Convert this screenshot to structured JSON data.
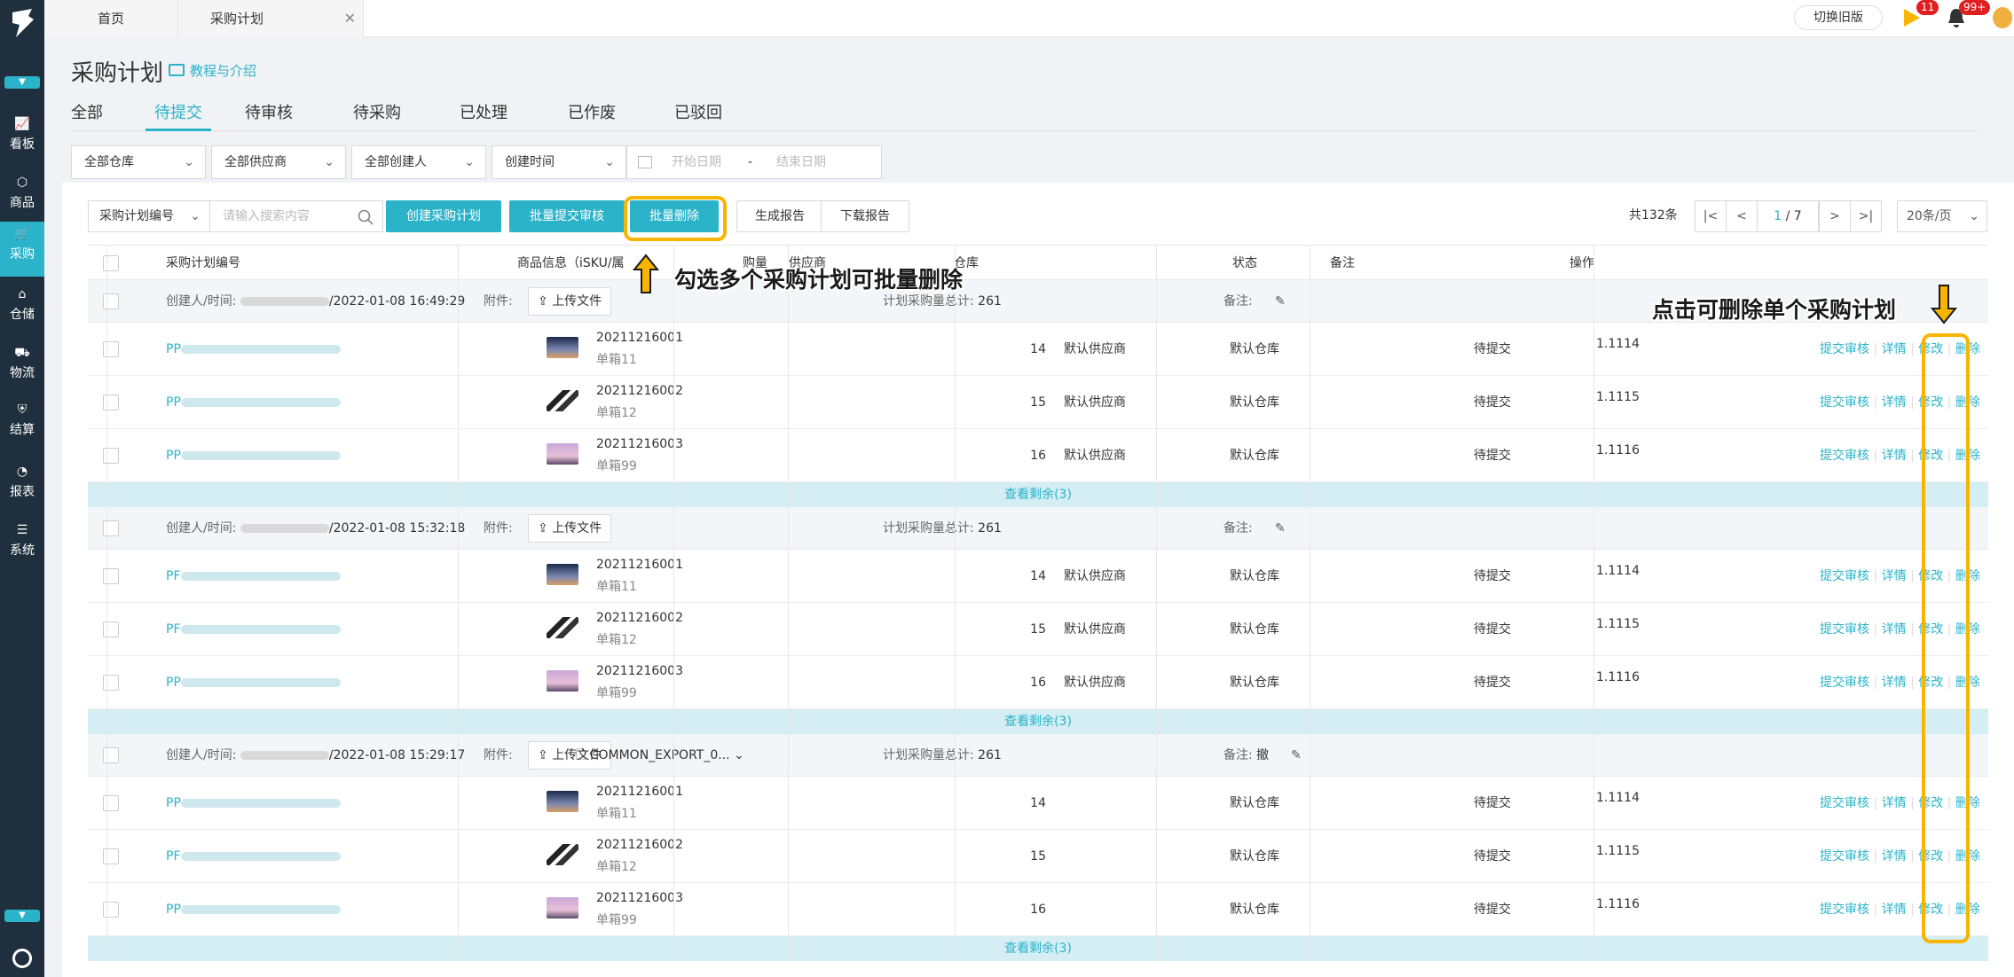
{
  "sidebar": {
    "items": [
      {
        "label": "看板",
        "icon": "chart-icon"
      },
      {
        "label": "商品",
        "icon": "box-icon"
      },
      {
        "label": "采购",
        "icon": "cart-icon"
      },
      {
        "label": "仓储",
        "icon": "warehouse-icon"
      },
      {
        "label": "物流",
        "icon": "truck-icon"
      },
      {
        "label": "结算",
        "icon": "shield-icon"
      },
      {
        "label": "报表",
        "icon": "pie-icon"
      },
      {
        "label": "系统",
        "icon": "list-icon"
      }
    ],
    "active_item": "采购"
  },
  "tabs": {
    "home": "首页",
    "current": "采购计划"
  },
  "header": {
    "old_version": "切换旧版",
    "flag_badge": "11",
    "bell_badge": "99+"
  },
  "page": {
    "title": "采购计划",
    "tutorial": "教程与介绍"
  },
  "status_tabs": [
    "全部",
    "待提交",
    "待审核",
    "待采购",
    "已处理",
    "已作废",
    "已驳回"
  ],
  "active_status_tab": "待提交",
  "filters": {
    "warehouse": "全部仓库",
    "supplier": "全部供应商",
    "creator": "全部创建人",
    "time": "创建时间",
    "start_placeholder": "开始日期",
    "sep": "-",
    "end_placeholder": "结束日期"
  },
  "toolbar": {
    "search_type": "采购计划编号",
    "search_placeholder": "请输入搜索内容",
    "create": "创建采购计划",
    "batch_submit": "批量提交审核",
    "batch_delete": "批量删除",
    "report": "生成报告",
    "download": "下载报告"
  },
  "pagination": {
    "total": "共132条",
    "current": "1",
    "pages": "/ 7",
    "per_page": "20条/页"
  },
  "table_headers": {
    "plan_no": "采购计划编号",
    "product": "商品信息（iSKU/属",
    "qty": "购量",
    "supplier": "供应商",
    "warehouse": "仓库",
    "status": "状态",
    "remark": "备注",
    "ops": "操作"
  },
  "group_labels": {
    "creator": "创建人/时间:",
    "attach": "附件:",
    "upload": "上传文件",
    "total": "计划采购量总计:",
    "remark": "备注:",
    "more": "查看剩余(3)"
  },
  "row_actions": {
    "submit": "提交审核",
    "detail": "详情",
    "edit": "修改",
    "delete": "删除"
  },
  "groups": [
    {
      "time": "/2022-01-08 16:49:29",
      "total": "261",
      "file": "",
      "remark": "",
      "rows": [
        {
          "pp": "PP",
          "sku": "20211216001",
          "box": "单箱11",
          "qty": "14",
          "supplier": "默认供应商",
          "warehouse": "默认仓库",
          "status": "待提交",
          "remark": "1.1114"
        },
        {
          "pp": "PP",
          "sku": "20211216002",
          "box": "单箱12",
          "qty": "15",
          "supplier": "默认供应商",
          "warehouse": "默认仓库",
          "status": "待提交",
          "remark": "1.1115"
        },
        {
          "pp": "PP",
          "sku": "20211216003",
          "box": "单箱99",
          "qty": "16",
          "supplier": "默认供应商",
          "warehouse": "默认仓库",
          "status": "待提交",
          "remark": "1.1116"
        }
      ]
    },
    {
      "time": "/2022-01-08 15:32:18",
      "total": "261",
      "file": "",
      "remark": "",
      "rows": [
        {
          "pp": "PF",
          "sku": "20211216001",
          "box": "单箱11",
          "qty": "14",
          "supplier": "默认供应商",
          "warehouse": "默认仓库",
          "status": "待提交",
          "remark": "1.1114"
        },
        {
          "pp": "PF",
          "sku": "20211216002",
          "box": "单箱12",
          "qty": "15",
          "supplier": "默认供应商",
          "warehouse": "默认仓库",
          "status": "待提交",
          "remark": "1.1115"
        },
        {
          "pp": "PP",
          "sku": "20211216003",
          "box": "单箱99",
          "qty": "16",
          "supplier": "默认供应商",
          "warehouse": "默认仓库",
          "status": "待提交",
          "remark": "1.1116"
        }
      ]
    },
    {
      "time": "/2022-01-08 15:29:17",
      "total": "261",
      "file": "COMMON_EXPORT_0...",
      "remark": "撤",
      "rows": [
        {
          "pp": "PP",
          "sku": "20211216001",
          "box": "单箱11",
          "qty": "14",
          "supplier": "",
          "warehouse": "默认仓库",
          "status": "待提交",
          "remark": "1.1114"
        },
        {
          "pp": "PF",
          "sku": "20211216002",
          "box": "单箱12",
          "qty": "15",
          "supplier": "",
          "warehouse": "默认仓库",
          "status": "待提交",
          "remark": "1.1115"
        },
        {
          "pp": "PP",
          "sku": "20211216003",
          "box": "单箱99",
          "qty": "16",
          "supplier": "",
          "warehouse": "默认仓库",
          "status": "待提交",
          "remark": "1.1116"
        }
      ]
    }
  ],
  "annotations": {
    "batch": "勾选多个采购计划可批量删除",
    "single": "点击可删除单个采购计划"
  },
  "colors": {
    "accent": "#2bb3c9",
    "sidebar": "#1f2f3d",
    "highlight": "#f7b500"
  }
}
